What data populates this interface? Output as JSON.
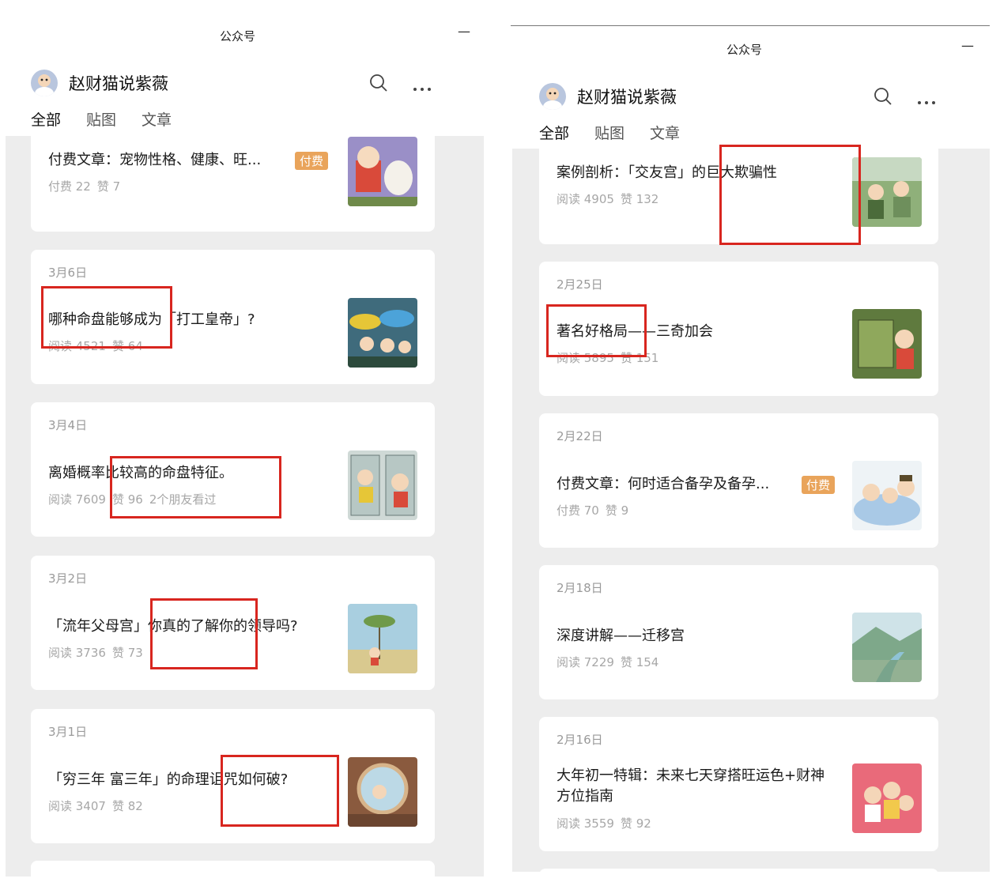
{
  "left": {
    "window_title": "公众号",
    "minimize": "—",
    "account_name": "赵财猫说紫薇",
    "tabs": [
      "全部",
      "贴图",
      "文章"
    ],
    "cards": [
      {
        "date": "",
        "title": "付费文章：宠物性格、健康、旺...",
        "badge": "付费",
        "meta": [
          "付费 22",
          "赞 7"
        ]
      },
      {
        "date": "3月6日",
        "title": "哪种命盘能够成为「打工皇帝」?",
        "meta": [
          "阅读 4521",
          "赞 64"
        ]
      },
      {
        "date": "3月4日",
        "title": "离婚概率比较高的命盘特征。",
        "meta": [
          "阅读 7609",
          "赞 96",
          "2个朋友看过"
        ]
      },
      {
        "date": "3月2日",
        "title": "「流年父母宫」你真的了解你的领导吗?",
        "meta": [
          "阅读 3736",
          "赞 73"
        ]
      },
      {
        "date": "3月1日",
        "title": "「穷三年 富三年」的命理诅咒如何破?",
        "meta": [
          "阅读 3407",
          "赞 82"
        ]
      }
    ]
  },
  "right": {
    "window_title": "公众号",
    "minimize": "—",
    "account_name": "赵财猫说紫薇",
    "tabs": [
      "全部",
      "贴图",
      "文章"
    ],
    "cards": [
      {
        "date": "",
        "title": "案例剖析：「交友宫」的巨大欺骗性",
        "meta": [
          "阅读 4905",
          "赞 132"
        ]
      },
      {
        "date": "2月25日",
        "title": "著名好格局——三奇加会",
        "meta": [
          "阅读 5895",
          "赞 151"
        ]
      },
      {
        "date": "2月22日",
        "title": "付费文章：何时适合备孕及备孕...",
        "badge": "付费",
        "meta": [
          "付费 70",
          "赞 9"
        ]
      },
      {
        "date": "2月18日",
        "title": "深度讲解——迁移宫",
        "meta": [
          "阅读 7229",
          "赞 154"
        ]
      },
      {
        "date": "2月16日",
        "title": "大年初一特辑：未来七天穿搭旺运色+财神方位指南",
        "meta": [
          "阅读 3559",
          "赞 92"
        ]
      }
    ]
  },
  "colors": {
    "accent_badge": "#e9a45b",
    "highlight_box": "#d8261f",
    "feed_bg": "#ededed"
  },
  "icons": [
    "avatar",
    "search-icon",
    "more-icon",
    "thumbnail-image"
  ]
}
